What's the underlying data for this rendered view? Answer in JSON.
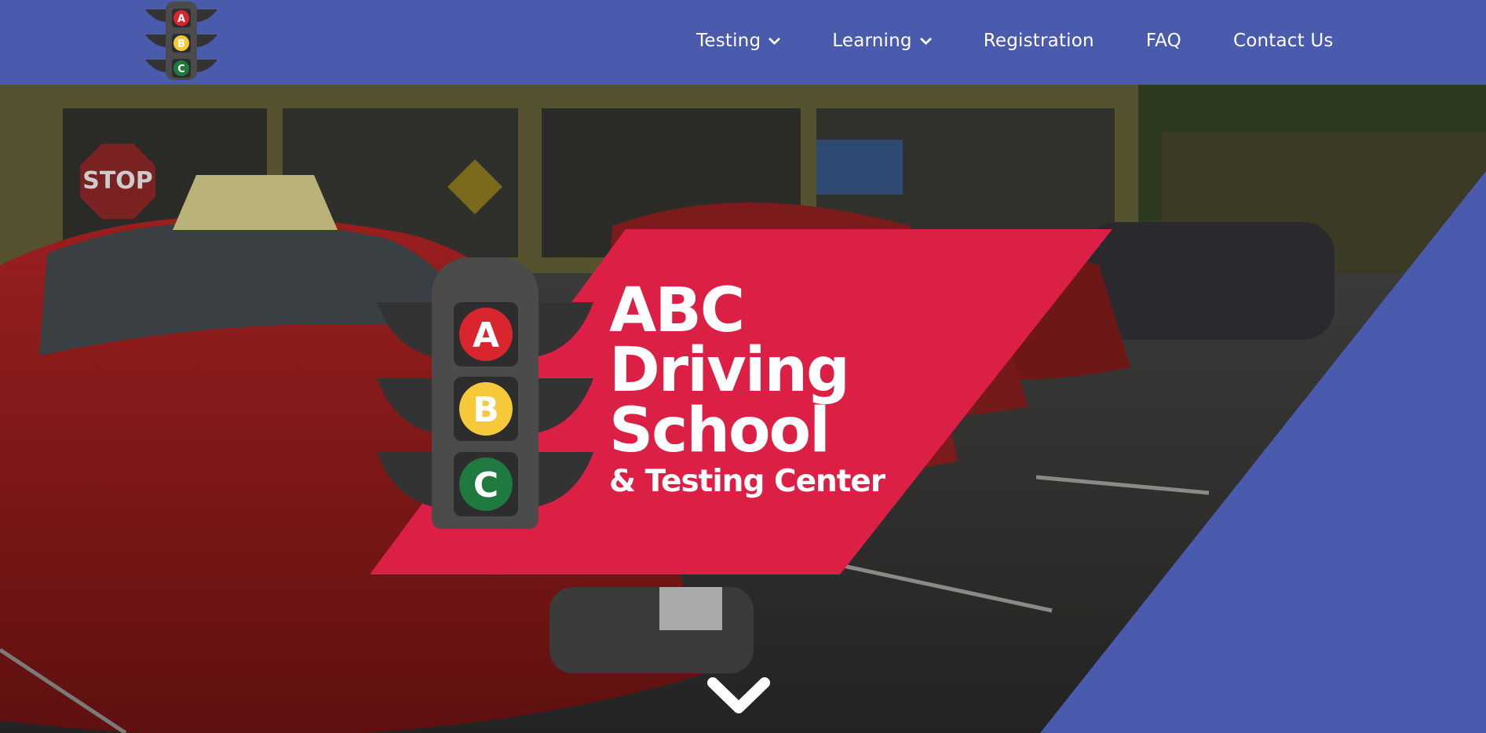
{
  "header": {
    "logo": {
      "icon": "traffic-light-logo-icon",
      "lights": [
        "A",
        "B",
        "C"
      ]
    },
    "nav": [
      {
        "label": "Testing",
        "has_dropdown": true
      },
      {
        "label": "Learning",
        "has_dropdown": true
      },
      {
        "label": "Registration",
        "has_dropdown": false
      },
      {
        "label": "FAQ",
        "has_dropdown": false
      },
      {
        "label": "Contact Us",
        "has_dropdown": false
      }
    ]
  },
  "hero": {
    "brand": {
      "line1": "ABC",
      "line2": "Driving",
      "line3": "School",
      "subtitle": "& Testing Center",
      "lights": [
        "A",
        "B",
        "C"
      ]
    },
    "scroll_icon": "chevron-down-icon"
  },
  "colors": {
    "header_bg": "#4a5aad",
    "banner_red": "#dc1f45",
    "light_red": "#d9262e",
    "light_yellow": "#f6c93b",
    "light_green": "#1f7a40",
    "signal_body": "#4b4b4b",
    "signal_frame": "#333333"
  }
}
